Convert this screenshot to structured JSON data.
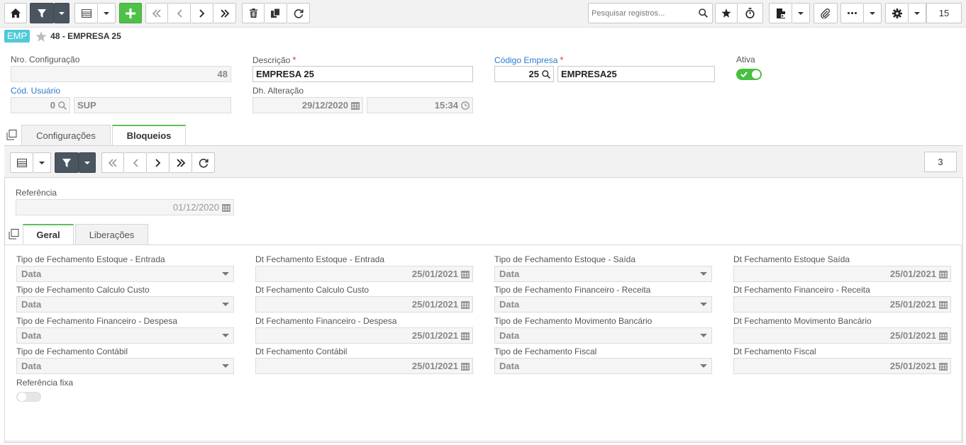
{
  "toolbar": {
    "search_placeholder": "Pesquisar registros...",
    "record_count": "15"
  },
  "breadcrumb": {
    "badge": "EMP",
    "title": "48 - EMPRESA 25"
  },
  "header_fields": {
    "nro_config": {
      "label": "Nro. Configuração",
      "value": "48"
    },
    "descricao": {
      "label": "Descrição",
      "value": "EMPRESA 25"
    },
    "codigo_empresa": {
      "label": "Código Empresa",
      "code": "25",
      "name": "EMPRESA25"
    },
    "ativa": {
      "label": "Ativa",
      "value": true
    },
    "cod_usuario": {
      "label": "Cód. Usuário",
      "code": "0",
      "name": "SUP"
    },
    "dh_alteracao": {
      "label": "Dh. Alteração",
      "date": "29/12/2020",
      "time": "15:34"
    }
  },
  "tabs": [
    {
      "label": "Configurações",
      "active": false
    },
    {
      "label": "Bloqueios",
      "active": true
    }
  ],
  "sub_record_count": "3",
  "referencia": {
    "label": "Referência",
    "value": "01/12/2020"
  },
  "inner_tabs": [
    {
      "label": "Geral",
      "active": true
    },
    {
      "label": "Liberações",
      "active": false
    }
  ],
  "grid": [
    [
      {
        "label": "Tipo de Fechamento Estoque - Entrada",
        "value": "Data",
        "kind": "select"
      },
      {
        "label": "Dt Fechamento Estoque - Entrada",
        "value": "25/01/2021",
        "kind": "date"
      },
      {
        "label": "Tipo de Fechamento Estoque - Saída",
        "value": "Data",
        "kind": "select"
      },
      {
        "label": "Dt Fechamento Estoque Saída",
        "value": "25/01/2021",
        "kind": "date"
      }
    ],
    [
      {
        "label": "Tipo de Fechamento Calculo Custo",
        "value": "Data",
        "kind": "select"
      },
      {
        "label": "Dt Fechamento Calculo Custo",
        "value": "25/01/2021",
        "kind": "date"
      },
      {
        "label": "Tipo de Fechamento Financeiro - Receita",
        "value": "Data",
        "kind": "select"
      },
      {
        "label": "Dt Fechamento Financeiro - Receita",
        "value": "25/01/2021",
        "kind": "date"
      }
    ],
    [
      {
        "label": "Tipo de Fechamento Financeiro - Despesa",
        "value": "Data",
        "kind": "select"
      },
      {
        "label": "Dt Fechamento Financeiro - Despesa",
        "value": "25/01/2021",
        "kind": "date"
      },
      {
        "label": "Tipo de Fechamento Movimento Bancário",
        "value": "Data",
        "kind": "select"
      },
      {
        "label": "Dt Fechamento Movimento Bancário",
        "value": "25/01/2021",
        "kind": "date"
      }
    ],
    [
      {
        "label": "Tipo de Fechamento Contábil",
        "value": "Data",
        "kind": "select"
      },
      {
        "label": "Dt Fechamento Contábil",
        "value": "25/01/2021",
        "kind": "date"
      },
      {
        "label": "Tipo de Fechamento Fiscal",
        "value": "Data",
        "kind": "select"
      },
      {
        "label": "Dt Fechamento Fiscal",
        "value": "25/01/2021",
        "kind": "date"
      }
    ]
  ],
  "referencia_fixa": {
    "label": "Referência fixa",
    "value": false
  },
  "colors": {
    "accent_green": "#4fc149",
    "badge_cyan": "#4fc9d9",
    "link_blue": "#2a7ccc",
    "required_red": "#d9342b"
  }
}
